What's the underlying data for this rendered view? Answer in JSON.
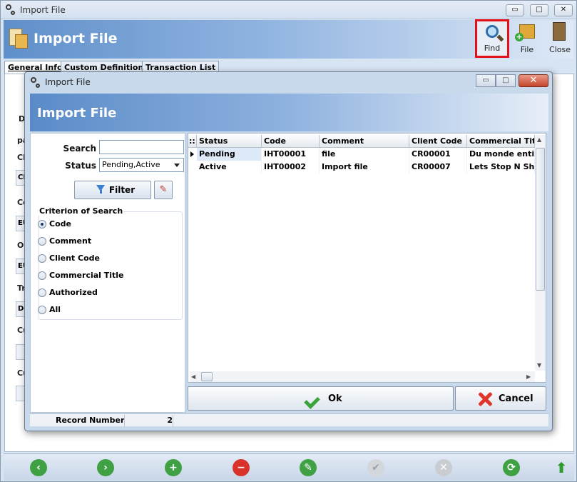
{
  "window": {
    "title": "Import File",
    "controls": [
      "▭",
      "□",
      "✕"
    ]
  },
  "header": {
    "title": "Import File"
  },
  "toolbar": {
    "find_label": "Find",
    "file_label": "File",
    "close_label": "Close"
  },
  "tabs": [
    "General Info",
    "Custom Definitions",
    "Transaction List"
  ],
  "background_labels": [
    "De",
    "pa",
    "Cli",
    "CR",
    "Co",
    "EU",
    "Or",
    "EU",
    "Tr",
    "De",
    "Cu",
    "Cu"
  ],
  "dialog": {
    "title": "Import File",
    "header_title": "Import File",
    "search_label": "Search",
    "search_value": "",
    "status_label": "Status",
    "status_value": "Pending,Active",
    "filter_label": "Filter",
    "criterion_title": "Criterion of Search",
    "criteria": [
      {
        "label": "Code",
        "selected": true
      },
      {
        "label": "Comment",
        "selected": false
      },
      {
        "label": "Client Code",
        "selected": false
      },
      {
        "label": "Commercial Title",
        "selected": false
      },
      {
        "label": "Authorized",
        "selected": false
      },
      {
        "label": "All",
        "selected": false
      }
    ],
    "grid": {
      "indicator_header": "::",
      "columns": [
        "Status",
        "Code",
        "Comment",
        "Client Code",
        "Commercial Title"
      ],
      "rows": [
        [
          "Pending",
          "IHT00001",
          "file",
          "CR00001",
          "Du monde entier"
        ],
        [
          "Active",
          "IHT00002",
          "Import file",
          "CR00007",
          "Lets Stop N Shop"
        ]
      ]
    },
    "ok_label": "Ok",
    "cancel_label": "Cancel",
    "record_label": "Record Number",
    "record_value": "2"
  },
  "colors": {
    "accent": "#5f8fca",
    "highlight": "#e3101a",
    "selected_row": "#dde9f7"
  }
}
